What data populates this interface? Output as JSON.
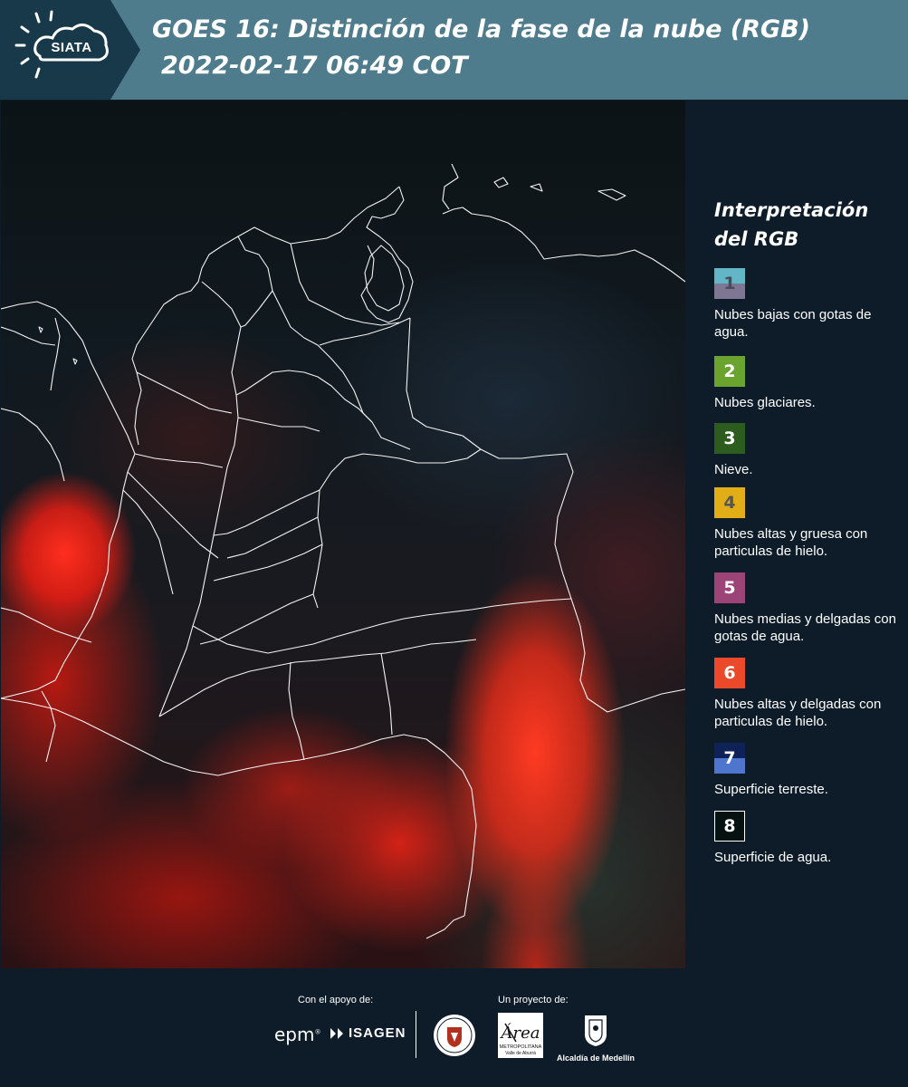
{
  "header": {
    "logo_text": "SIATA",
    "title": "GOES 16: Distinción de la fase de la nube (RGB)",
    "subtitle": "2022-02-17 06:49 COT",
    "background_color": "#4f7c8c"
  },
  "map": {
    "description_visible": "satellite RGB cloud phase imagery over Colombia with white department borders",
    "border_color": "#ffffff"
  },
  "legend": {
    "title_line1": "Interpretación",
    "title_line2": "del RGB",
    "items": [
      {
        "number": "1",
        "label": "Nubes bajas con gotas de agua.",
        "color_top": "#63b6c6",
        "color_bottom": "#7d7793",
        "text_color": "#4a4a5a"
      },
      {
        "number": "2",
        "label": "Nubes glaciares.",
        "color_top": "#6aa42f",
        "color_bottom": "#6aa42f",
        "text_color": "#ffffff"
      },
      {
        "number": "3",
        "label": "Nieve.",
        "color_top": "#2c5c1e",
        "color_bottom": "#2c5c1e",
        "text_color": "#ffffff"
      },
      {
        "number": "4",
        "label": "Nubes altas y gruesa con particulas de hielo.",
        "color_top": "#e1ae17",
        "color_bottom": "#e1ae17",
        "text_color": "#555555"
      },
      {
        "number": "5",
        "label": "Nubes medias y delgadas con gotas de agua.",
        "color_top": "#9c4478",
        "color_bottom": "#9c4478",
        "text_color": "#ffffff"
      },
      {
        "number": "6",
        "label": "Nubes altas y delgadas con particulas de hielo.",
        "color_top": "#ea4a2a",
        "color_bottom": "#ea4a2a",
        "text_color": "#ffffff"
      },
      {
        "number": "7",
        "label": "Superficie terreste.",
        "color_top": "#0e2258",
        "color_bottom": "#4f76cf",
        "text_color": "#ffffff"
      },
      {
        "number": "8",
        "label": "Superficie de agua.",
        "color_top": "#061210",
        "color_bottom": "#061210",
        "text_color": "#ffffff"
      }
    ]
  },
  "footer": {
    "support_caption": "Con el apoyo de:",
    "project_caption": "Un proyecto de:",
    "epm_text": "epm",
    "isagen_text": "ISAGEN",
    "area_text": "Área",
    "area_sub1": "METROPOLITANA",
    "area_sub2": "Valle de Aburrá",
    "alcaldia_text": "Alcaldía de Medellín"
  }
}
